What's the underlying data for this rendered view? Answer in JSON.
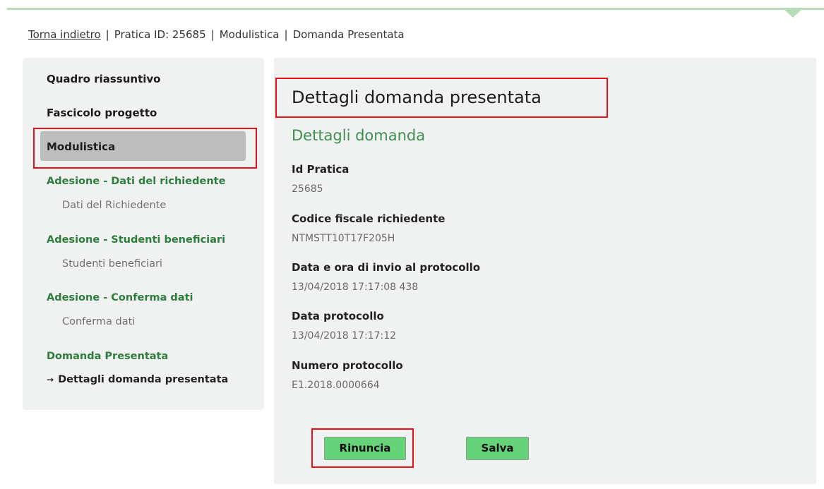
{
  "breadcrumb": {
    "back": "Torna indietro",
    "separator": "|",
    "pratica": "Pratica ID: 25685",
    "modulistica": "Modulistica",
    "domanda": "Domanda Presentata"
  },
  "sidebar": {
    "quadro": "Quadro riassuntivo",
    "fascicolo": "Fascicolo progetto",
    "modulistica": "Modulistica",
    "sections": [
      {
        "title": "Adesione - Dati del richiedente",
        "item": "Dati del Richiedente"
      },
      {
        "title": "Adesione - Studenti beneficiari",
        "item": "Studenti beneficiari"
      },
      {
        "title": "Adesione - Conferma dati",
        "item": "Conferma dati"
      },
      {
        "title": "Domanda Presentata",
        "item": "Dettagli domanda presentata"
      }
    ],
    "current_arrow": "→"
  },
  "content": {
    "title": "Dettagli domanda presentata",
    "section_title": "Dettagli domanda",
    "fields": [
      {
        "label": "Id Pratica",
        "value": "25685"
      },
      {
        "label": "Codice fiscale richiedente",
        "value": "NTMSTT10T17F205H"
      },
      {
        "label": "Data e ora di invio al protocollo",
        "value": "13/04/2018 17:17:08 438"
      },
      {
        "label": "Data protocollo",
        "value": "13/04/2018 17:17:12"
      },
      {
        "label": "Numero protocollo",
        "value": "E1.2018.0000664"
      }
    ]
  },
  "buttons": {
    "rinuncia": "Rinuncia",
    "salva": "Salva"
  },
  "colors": {
    "accent_green": "#3e8f4f",
    "button_green": "#66d27a",
    "highlight_red": "#e8101a",
    "panel_bg": "#f0f2f2"
  }
}
